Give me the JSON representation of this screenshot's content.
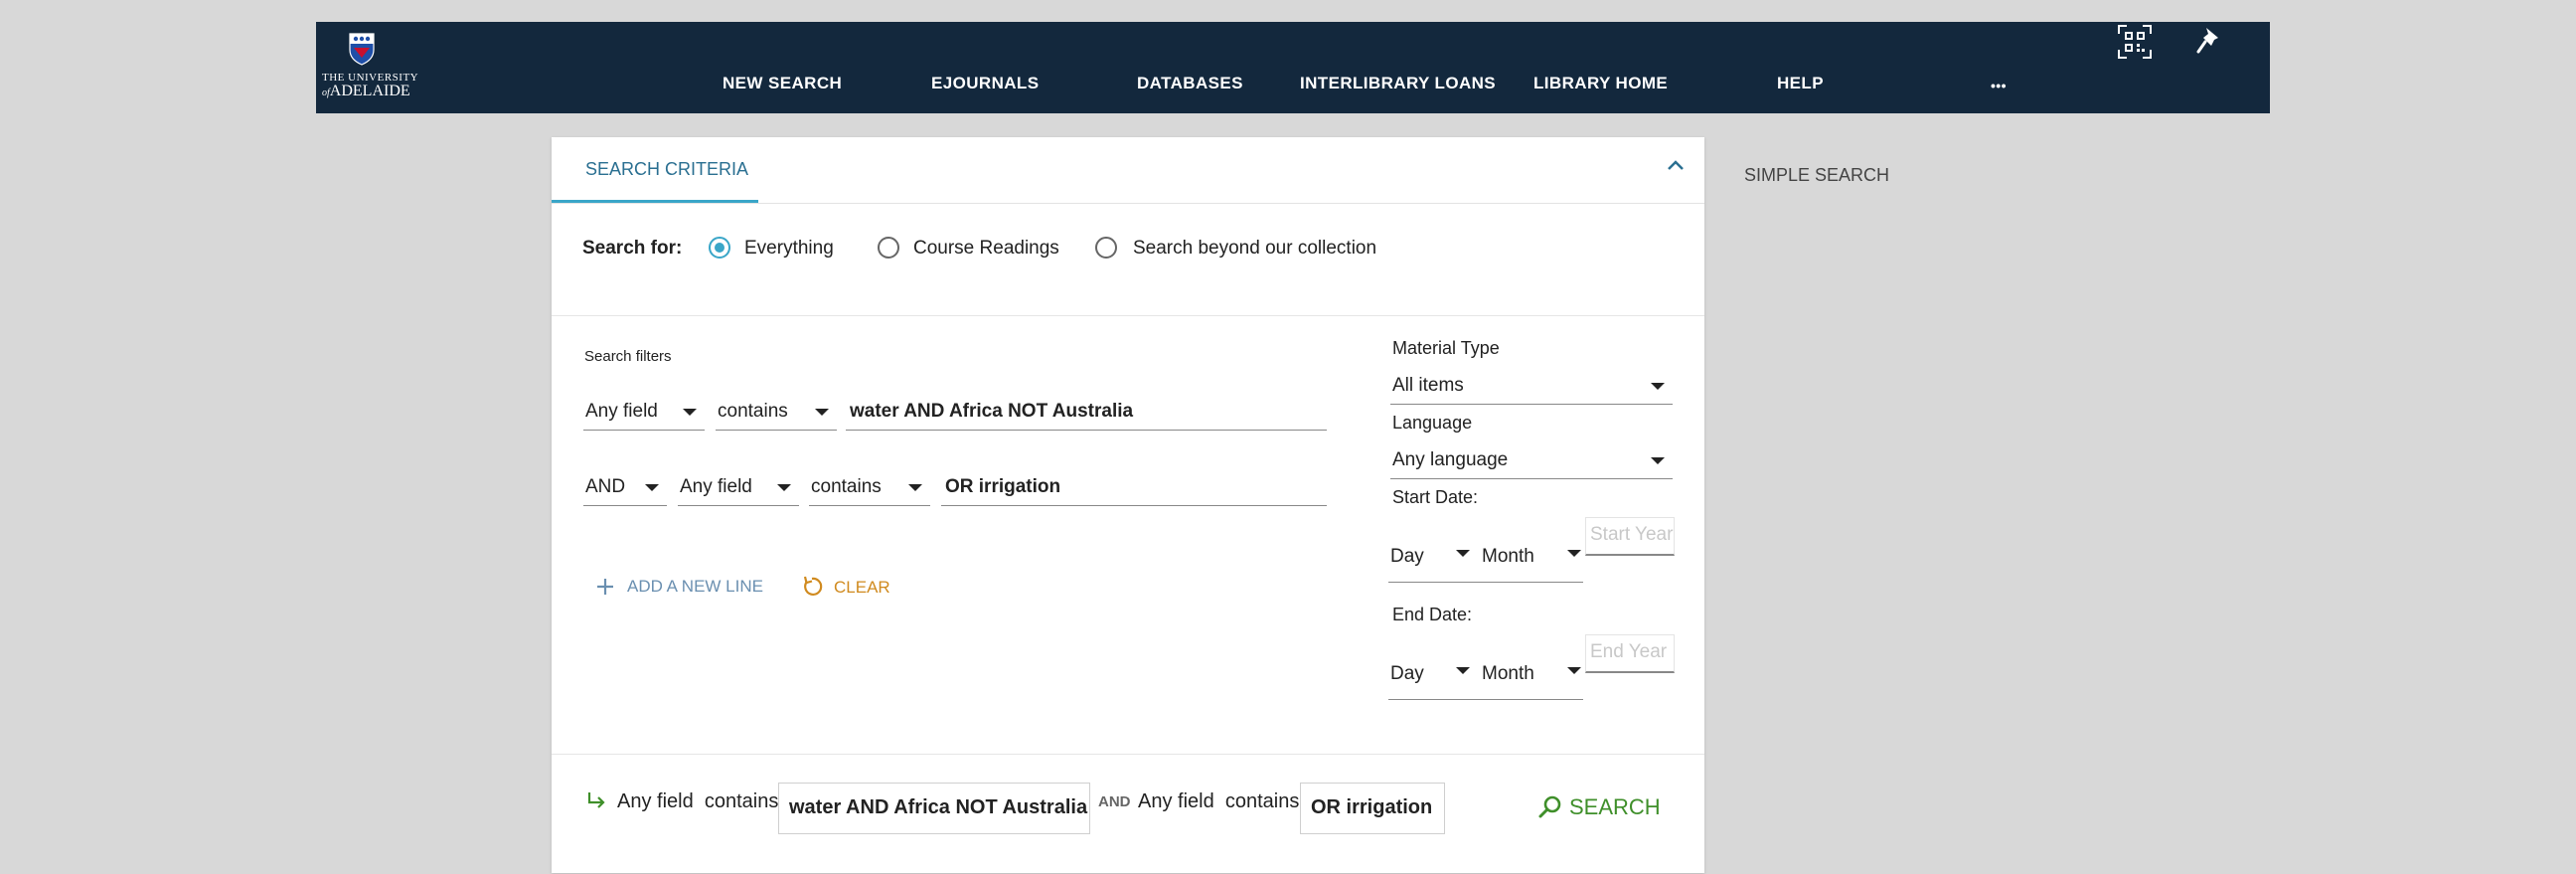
{
  "header": {
    "logo_line1": "THE UNIVERSITY",
    "logo_line2": "ADELAIDE",
    "logo_of": "of",
    "nav": [
      "NEW SEARCH",
      "EJOURNALS",
      "DATABASES",
      "INTERLIBRARY LOANS",
      "LIBRARY HOME",
      "HELP"
    ],
    "more_label": "•••",
    "icons": [
      "qr-code-icon",
      "pin-icon"
    ]
  },
  "search_panel": {
    "tab_label": "SEARCH CRITERIA",
    "search_for_label": "Search for:",
    "scopes": [
      {
        "label": "Everything",
        "selected": true
      },
      {
        "label": "Course Readings",
        "selected": false
      },
      {
        "label": "Search beyond our collection",
        "selected": false
      }
    ],
    "filters_label": "Search filters",
    "line1": {
      "field": "Any field",
      "operator": "contains",
      "value": "water AND Africa NOT Australia"
    },
    "line2": {
      "boolean": "AND",
      "field": "Any field",
      "operator": "contains",
      "value": "OR irrigation"
    },
    "add_line_label": "ADD A NEW LINE",
    "clear_label": "CLEAR"
  },
  "refine": {
    "material_type_label": "Material Type",
    "material_type_value": "All items",
    "language_label": "Language",
    "language_value": "Any language",
    "start_date_label": "Start Date:",
    "end_date_label": "End Date:",
    "day_label": "Day",
    "month_label": "Month",
    "start_year_placeholder": "Start Year",
    "end_year_placeholder": "End Year"
  },
  "summary": {
    "field1": "Any field",
    "op1": "contains",
    "value1": "water AND Africa NOT Australia",
    "bool": "AND",
    "field2": "Any field",
    "op2": "contains",
    "value2": "OR irrigation",
    "search_label": "SEARCH"
  },
  "side": {
    "simple_search_label": "SIMPLE SEARCH"
  },
  "colors": {
    "header_bg": "#13283d",
    "accent": "#3aa6c8",
    "tab_text": "#2a6f91",
    "clear": "#d08a1e",
    "search": "#3f8f2a"
  }
}
